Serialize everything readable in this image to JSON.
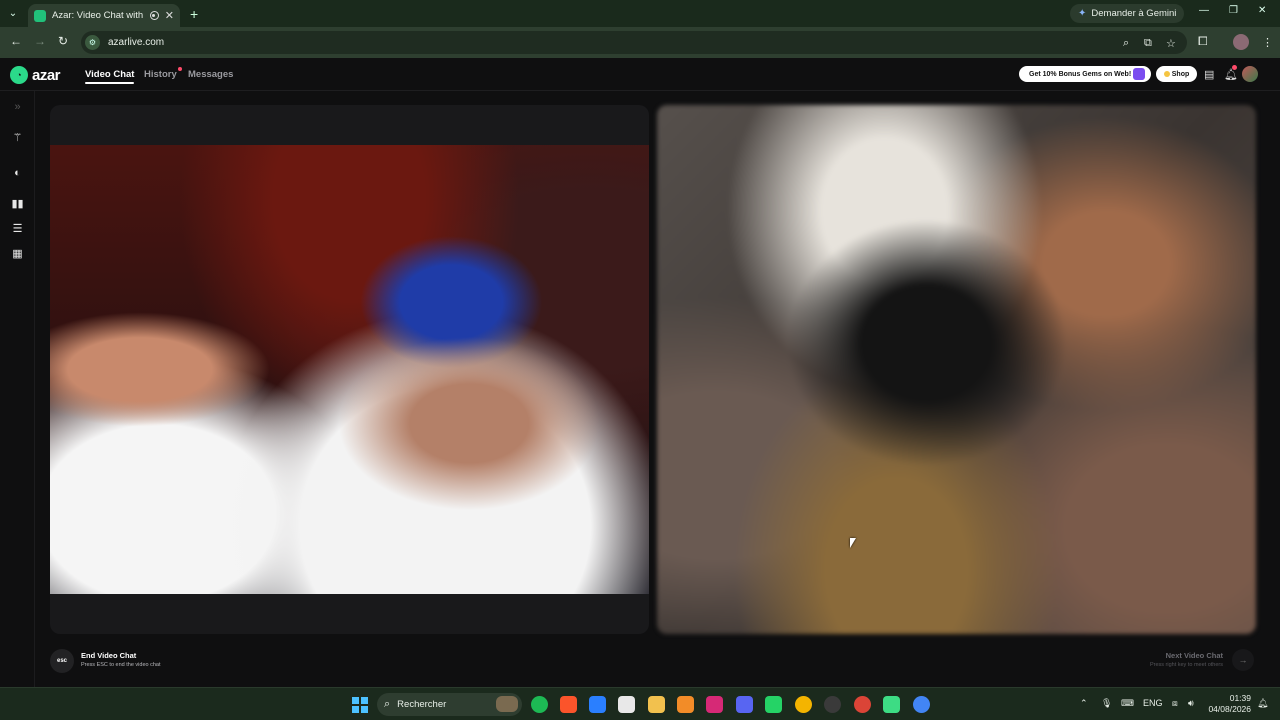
{
  "browser": {
    "tab_title": "Azar: Video Chat with New",
    "url": "azarlive.com",
    "gemini_label": "Demander à Gemini"
  },
  "header": {
    "logo_text": "azar",
    "nav": [
      {
        "label": "Video Chat",
        "active": true
      },
      {
        "label": "History",
        "active": false,
        "has_dot": true
      },
      {
        "label": "Messages",
        "active": false
      }
    ],
    "gems_promo": "Get 10% Bonus Gems on Web!",
    "shop_label": "Shop"
  },
  "sidebar": {
    "icons": [
      "collapse-icon",
      "magic-wand-icon",
      "filter-icon",
      "layout-side-by-side-icon",
      "layout-stacked-icon",
      "layout-grid-icon"
    ]
  },
  "controls": {
    "esc_key": "esc",
    "end_title": "End Video Chat",
    "end_sub": "Press ESC to end the video chat",
    "next_title": "Next Video Chat",
    "next_sub": "Press right key to meet others"
  },
  "taskbar": {
    "search_text": "Rechercher",
    "lang": "ENG",
    "time": "01:39",
    "date": "04/08/2026"
  }
}
